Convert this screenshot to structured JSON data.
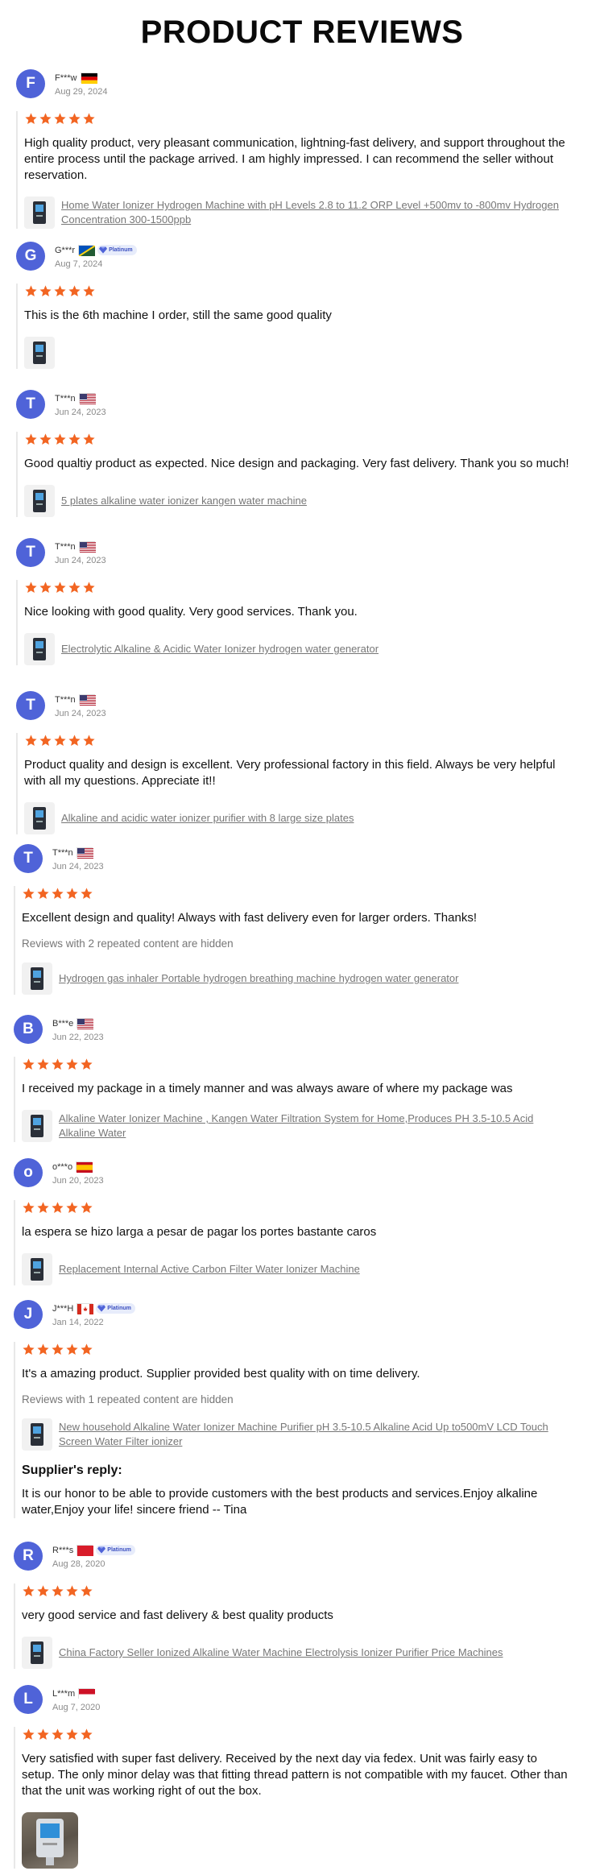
{
  "page_title": "PRODUCT REVIEWS",
  "colors": {
    "avatar": "#4f63d8",
    "star": "#f26522",
    "badge_bg": "#e7ecfb"
  },
  "reviews": [
    {
      "initial": "F",
      "name": "F***w",
      "flag": "germany",
      "badge": "",
      "date": "Aug 29, 2024",
      "rating": 5,
      "text": "High quality product, very pleasant communication, lightning-fast delivery, and support throughout the entire process until the package arrived. I am highly impressed. I can recommend the seller without reservation.",
      "hidden_note": "",
      "product": "Home Water Ionizer Hydrogen Machine with pH Levels 2.8 to 11.2 ORP Level +500mv to -800mv Hydrogen Concentration 300-1500ppb"
    },
    {
      "initial": "G",
      "name": "G***r",
      "flag": "solomon-islands",
      "badge": "Platinum",
      "date": "Aug 7, 2024",
      "rating": 5,
      "text": "This is the 6th machine I order, still the same good quality",
      "hidden_note": "",
      "product": ""
    },
    {
      "initial": "T",
      "name": "T***n",
      "flag": "usa",
      "badge": "",
      "date": "Jun 24, 2023",
      "rating": 5,
      "text": "Good qualtiy product as expected. Nice design and packaging. Very fast delivery. Thank you so much!",
      "hidden_note": "",
      "product": "5 plates alkaline water ionizer kangen water machine"
    },
    {
      "initial": "T",
      "name": "T***n",
      "flag": "usa",
      "badge": "",
      "date": "Jun 24, 2023",
      "rating": 5,
      "text": "Nice looking with good quality. Very good services. Thank you.",
      "hidden_note": "",
      "product": "Electrolytic Alkaline & Acidic Water Ionizer hydrogen water generator"
    },
    {
      "initial": "T",
      "name": "T***n",
      "flag": "usa",
      "badge": "",
      "date": "Jun 24, 2023",
      "rating": 5,
      "text": "Product quality and design is excellent. Very professional factory in this field. Always be very helpful with all my questions. Appreciate it!!",
      "hidden_note": "",
      "product": "Alkaline and acidic water ionizer purifier with 8 large size plates"
    },
    {
      "initial": "T",
      "name": "T***n",
      "flag": "usa",
      "badge": "",
      "date": "Jun 24, 2023",
      "rating": 5,
      "text": "Excellent design and quality! Always with fast delivery even for larger orders. Thanks!",
      "hidden_note": "Reviews with 2 repeated content are hidden",
      "product": "Hydrogen gas inhaler Portable hydrogen breathing machine hydrogen water generator"
    },
    {
      "initial": "B",
      "name": "B***e",
      "flag": "usa",
      "badge": "",
      "date": "Jun 22, 2023",
      "rating": 5,
      "text": "I received my package in a timely manner and was always aware of where my package was",
      "hidden_note": "",
      "product": "Alkaline Water Ionizer Machine , Kangen Water Filtration System for Home,Produces PH 3.5-10.5 Acid Alkaline Water"
    },
    {
      "initial": "o",
      "name": "o***o",
      "flag": "spain",
      "badge": "",
      "date": "Jun 20, 2023",
      "rating": 5,
      "text": "la espera se hizo larga a pesar de pagar los portes bastante caros",
      "hidden_note": "",
      "product": "Replacement Internal Active Carbon Filter Water Ionizer Machine"
    },
    {
      "initial": "J",
      "name": "J***H",
      "flag": "canada",
      "badge": "Platinum",
      "date": "Jan 14, 2022",
      "rating": 5,
      "text": "It's a amazing product. Supplier provided best quality with on time delivery.",
      "hidden_note": "Reviews with 1 repeated content are hidden",
      "product": "New household Alkaline Water Ionizer Machine Purifier pH 3.5-10.5 Alkaline Acid Up to500mV LCD Touch Screen Water Filter ionizer",
      "reply_title": "Supplier's reply:",
      "reply_text": "It is our honor to be able to provide customers with the best products and services.Enjoy alkaline water,Enjoy your life! sincere friend -- Tina"
    },
    {
      "initial": "R",
      "name": "R***s",
      "flag": "red",
      "badge": "Platinum",
      "date": "Aug 28, 2020",
      "rating": 5,
      "text": "very good service and fast delivery & best quality products",
      "hidden_note": "",
      "product": "China Factory Seller Ionized Alkaline Water Machine Electrolysis Ionizer Purifier Price Machines"
    },
    {
      "initial": "L",
      "name": "L***m",
      "flag": "indonesia",
      "badge": "",
      "date": "Aug 7, 2020",
      "rating": 5,
      "text": "Very satisfied with super fast delivery. Received by the next day via fedex. Unit was fairly easy to setup. The only minor delay was that fitting thread pattern is not compatible with my faucet. Other than that the unit was working right of out the box.",
      "hidden_note": "",
      "product": ""
    }
  ]
}
